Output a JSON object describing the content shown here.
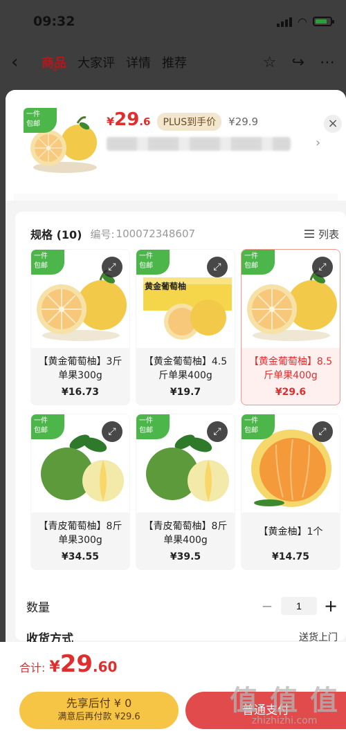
{
  "status_bar": {
    "time": "09:32"
  },
  "nav": {
    "tabs": [
      {
        "label": "商品",
        "active": true
      },
      {
        "label": "大家评",
        "active": false
      },
      {
        "label": "详情",
        "active": false
      },
      {
        "label": "推荐",
        "active": false
      }
    ]
  },
  "summary": {
    "badge": "一件\n包邮",
    "price_symbol": "¥",
    "price_int": "29",
    "price_dec": ".6",
    "plus_tag": "PLUS到手价",
    "orig_price": "¥29.9"
  },
  "spec": {
    "title": "规格 (10)",
    "code_label": "编号:",
    "code": "100072348607",
    "list_toggle": "列表",
    "items": [
      {
        "badge": "一件\n包邮",
        "name": "【黄金葡萄柚】3斤单果300g",
        "price": "¥16.73",
        "selected": false,
        "image": "golden-grapefruit"
      },
      {
        "badge": "一件\n包邮",
        "name": "【黄金葡萄柚】4.5斤单果400g",
        "price": "¥19.7",
        "selected": false,
        "image": "golden-grapefruit-box",
        "box_label": "黄金葡萄柚"
      },
      {
        "badge": "一件\n包邮",
        "name": "【黄金葡萄柚】8.5斤单果400g",
        "price": "¥29.6",
        "selected": true,
        "image": "golden-grapefruit"
      },
      {
        "badge": "一件\n包邮",
        "name": "【青皮葡萄柚】8斤单果300g",
        "price": "¥34.55",
        "selected": false,
        "image": "green-grapefruit"
      },
      {
        "badge": "一件\n包邮",
        "name": "【青皮葡萄柚】8斤单果400g",
        "price": "¥39.5",
        "selected": false,
        "image": "green-grapefruit"
      },
      {
        "badge": "一件\n包邮",
        "name": "【黄金柚】1个",
        "price": "¥14.75",
        "selected": false,
        "image": "pomelo"
      }
    ]
  },
  "quantity": {
    "label": "数量",
    "value": "1"
  },
  "shipping": {
    "label": "收货方式",
    "value": "送货上门"
  },
  "footer": {
    "total_label": "合计:",
    "total_symbol": "¥",
    "total_int": "29",
    "total_dec": ".60",
    "bnpl_line1": "先享后付 ¥ 0",
    "bnpl_line2": "满意后再付款 ¥29.6",
    "pay_label": "普通支付"
  },
  "watermark": {
    "main": "值 值 值",
    "sub": "zhizhizhi.com"
  },
  "colors": {
    "accent_red": "#e02d2d",
    "badge_green": "#4db64a",
    "bnpl_yellow": "#f7c545",
    "pay_red": "#e24b4b"
  }
}
